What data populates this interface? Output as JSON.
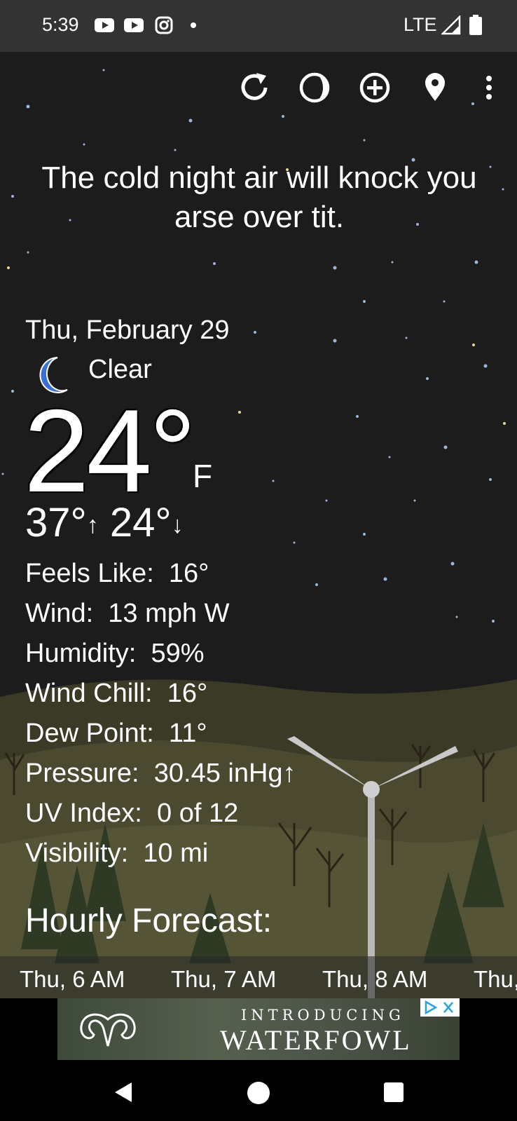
{
  "status_bar": {
    "time": "5:39",
    "network": "LTE",
    "notification_icons": [
      "youtube-icon",
      "youtube-icon",
      "instagram-icon",
      "dot-icon"
    ]
  },
  "toolbar": {
    "icons": [
      "refresh-icon",
      "moon-phase-icon",
      "add-location-icon",
      "location-pin-icon",
      "more-options-icon"
    ]
  },
  "tagline": "The cold night air will knock you arse over tit.",
  "current": {
    "date": "Thu, February 29",
    "condition": "Clear",
    "condition_icon": "crescent-moon-icon",
    "temperature": "24°",
    "unit": "F",
    "high": "37°",
    "low": "24°"
  },
  "details": [
    {
      "label": "Feels Like:",
      "value": "16°"
    },
    {
      "label": "Wind:",
      "value": "13 mph W"
    },
    {
      "label": "Humidity:",
      "value": "59%"
    },
    {
      "label": "Wind Chill:",
      "value": "16°"
    },
    {
      "label": "Dew Point:",
      "value": "11°"
    },
    {
      "label": "Pressure:",
      "value": "30.45 inHg↑"
    },
    {
      "label": "UV Index:",
      "value": "0 of 12"
    },
    {
      "label": "Visibility:",
      "value": "10 mi"
    }
  ],
  "hourly": {
    "title": "Hourly Forecast:",
    "hours": [
      "Thu, 6 AM",
      "Thu, 7 AM",
      "Thu, 8 AM",
      "Thu,"
    ]
  },
  "ad": {
    "line1": "INTRODUCING",
    "line2": "WATERFOWL"
  },
  "colors": {
    "status_bar": "#333333",
    "night_sky": "#1c1c1c",
    "moon_blue": "#3a6fd8",
    "hills": "#4b4a30"
  }
}
